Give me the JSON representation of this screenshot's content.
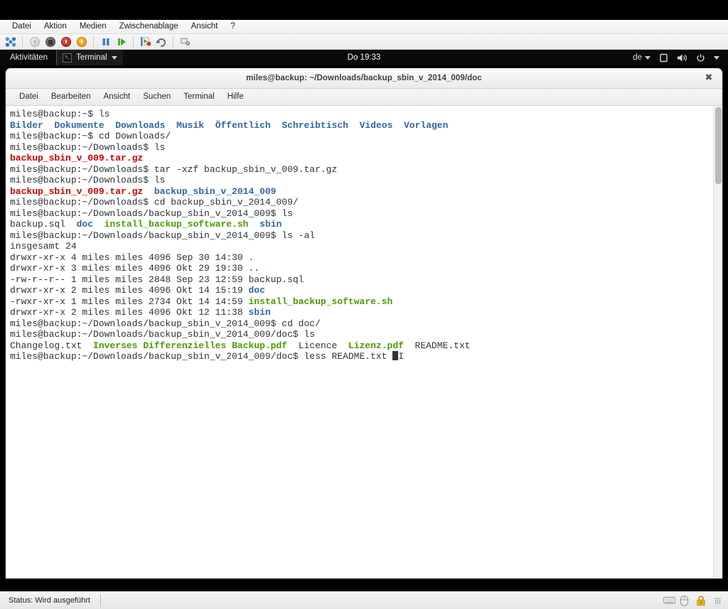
{
  "host": {
    "menu": [
      {
        "label": "Datei"
      },
      {
        "label": "Aktion"
      },
      {
        "label": "Medien"
      },
      {
        "label": "Zwischenablage"
      },
      {
        "label": "Ansicht"
      },
      {
        "label": "?"
      }
    ],
    "toolbar_icons": [
      "virtual-machine-icon",
      "power-off-icon",
      "stop-icon",
      "shutdown-icon",
      "power-on-icon",
      "pause-icon",
      "resume-icon",
      "snapshot-icon",
      "revert-icon",
      "settings-icon"
    ],
    "status": {
      "text": "Status: Wird ausgeführt",
      "tray_icons": [
        "keyboard-icon",
        "mouse-icon",
        "lock-icon"
      ]
    }
  },
  "panel": {
    "activities": "Aktivitäten",
    "app_name": "Terminal",
    "app_icon": "terminal-icon",
    "clock": "Do 19:33",
    "keyboard_layout": "de",
    "indicators": [
      "screen-icon",
      "volume-icon",
      "power-icon"
    ]
  },
  "terminal": {
    "title": "miles@backup: ~/Downloads/backup_sbin_v_2014_009/doc",
    "close_label": "✖",
    "menu": [
      {
        "label": "Datei"
      },
      {
        "label": "Bearbeiten"
      },
      {
        "label": "Ansicht"
      },
      {
        "label": "Suchen"
      },
      {
        "label": "Terminal"
      },
      {
        "label": "Hilfe"
      }
    ],
    "lines": [
      [
        {
          "t": "miles@backup:~$ ls",
          "c": "def"
        }
      ],
      [
        {
          "t": "Bilder",
          "c": "dir"
        },
        {
          "t": "  ",
          "c": "def"
        },
        {
          "t": "Dokumente",
          "c": "dir"
        },
        {
          "t": "  ",
          "c": "def"
        },
        {
          "t": "Downloads",
          "c": "dir"
        },
        {
          "t": "  ",
          "c": "def"
        },
        {
          "t": "Musik",
          "c": "dir"
        },
        {
          "t": "  ",
          "c": "def"
        },
        {
          "t": "Öffentlich",
          "c": "dir"
        },
        {
          "t": "  ",
          "c": "def"
        },
        {
          "t": "Schreibtisch",
          "c": "dir"
        },
        {
          "t": "  ",
          "c": "def"
        },
        {
          "t": "Videos",
          "c": "dir"
        },
        {
          "t": "  ",
          "c": "def"
        },
        {
          "t": "Vorlagen",
          "c": "dir"
        }
      ],
      [
        {
          "t": "miles@backup:~$ cd Downloads/",
          "c": "def"
        }
      ],
      [
        {
          "t": "miles@backup:~/Downloads$ ls",
          "c": "def"
        }
      ],
      [
        {
          "t": "backup_sbin_v_009.tar.gz",
          "c": "arch"
        }
      ],
      [
        {
          "t": "miles@backup:~/Downloads$ tar -xzf backup_sbin_v_009.tar.gz",
          "c": "def"
        }
      ],
      [
        {
          "t": "miles@backup:~/Downloads$ ls",
          "c": "def"
        }
      ],
      [
        {
          "t": "backup_sbin_v_009.tar.gz",
          "c": "arch"
        },
        {
          "t": "  ",
          "c": "def"
        },
        {
          "t": "backup_sbin_v_2014_009",
          "c": "dir"
        }
      ],
      [
        {
          "t": "miles@backup:~/Downloads$ cd backup_sbin_v_2014_009/",
          "c": "def"
        }
      ],
      [
        {
          "t": "miles@backup:~/Downloads/backup_sbin_v_2014_009$ ls",
          "c": "def"
        }
      ],
      [
        {
          "t": "backup.sql",
          "c": "def"
        },
        {
          "t": "  ",
          "c": "def"
        },
        {
          "t": "doc",
          "c": "dir"
        },
        {
          "t": "  ",
          "c": "def"
        },
        {
          "t": "install_backup_software.sh",
          "c": "exec"
        },
        {
          "t": "  ",
          "c": "def"
        },
        {
          "t": "sbin",
          "c": "dir"
        }
      ],
      [
        {
          "t": "miles@backup:~/Downloads/backup_sbin_v_2014_009$ ls -al",
          "c": "def"
        }
      ],
      [
        {
          "t": "insgesamt 24",
          "c": "def"
        }
      ],
      [
        {
          "t": "drwxr-xr-x 4 miles miles 4096 Sep 30 14:30 ",
          "c": "def"
        },
        {
          "t": ".",
          "c": "dir"
        }
      ],
      [
        {
          "t": "drwxr-xr-x 3 miles miles 4096 Okt 29 19:30 ",
          "c": "def"
        },
        {
          "t": "..",
          "c": "dir"
        }
      ],
      [
        {
          "t": "-rw-r--r-- 1 miles miles 2848 Sep 23 12:59 backup.sql",
          "c": "def"
        }
      ],
      [
        {
          "t": "drwxr-xr-x 2 miles miles 4096 Okt 14 15:19 ",
          "c": "def"
        },
        {
          "t": "doc",
          "c": "dir"
        }
      ],
      [
        {
          "t": "-rwxr-xr-x 1 miles miles 2734 Okt 14 14:59 ",
          "c": "def"
        },
        {
          "t": "install_backup_software.sh",
          "c": "exec"
        }
      ],
      [
        {
          "t": "drwxr-xr-x 2 miles miles 4096 Okt 12 11:38 ",
          "c": "def"
        },
        {
          "t": "sbin",
          "c": "dir"
        }
      ],
      [
        {
          "t": "miles@backup:~/Downloads/backup_sbin_v_2014_009$ cd doc/",
          "c": "def"
        }
      ],
      [
        {
          "t": "miles@backup:~/Downloads/backup_sbin_v_2014_009/doc$ ls",
          "c": "def"
        }
      ],
      [
        {
          "t": "Changelog.txt",
          "c": "def"
        },
        {
          "t": "  ",
          "c": "def"
        },
        {
          "t": "Inverses Differenzielles Backup.pdf",
          "c": "exec"
        },
        {
          "t": "  ",
          "c": "def"
        },
        {
          "t": "Licence",
          "c": "def"
        },
        {
          "t": "  ",
          "c": "def"
        },
        {
          "t": "Lizenz.pdf",
          "c": "exec"
        },
        {
          "t": "  ",
          "c": "def"
        },
        {
          "t": "README.txt",
          "c": "def"
        }
      ],
      [
        {
          "t": "miles@backup:~/Downloads/backup_sbin_v_2014_009/doc$ less README.txt ",
          "c": "def"
        },
        {
          "t": "CURSOR",
          "c": "cursor"
        }
      ]
    ],
    "colors": {
      "directory": "#3465a4",
      "archive": "#cc0000",
      "executable": "#4e9a06",
      "default": "#2e3436",
      "background": "#ffffff"
    }
  }
}
